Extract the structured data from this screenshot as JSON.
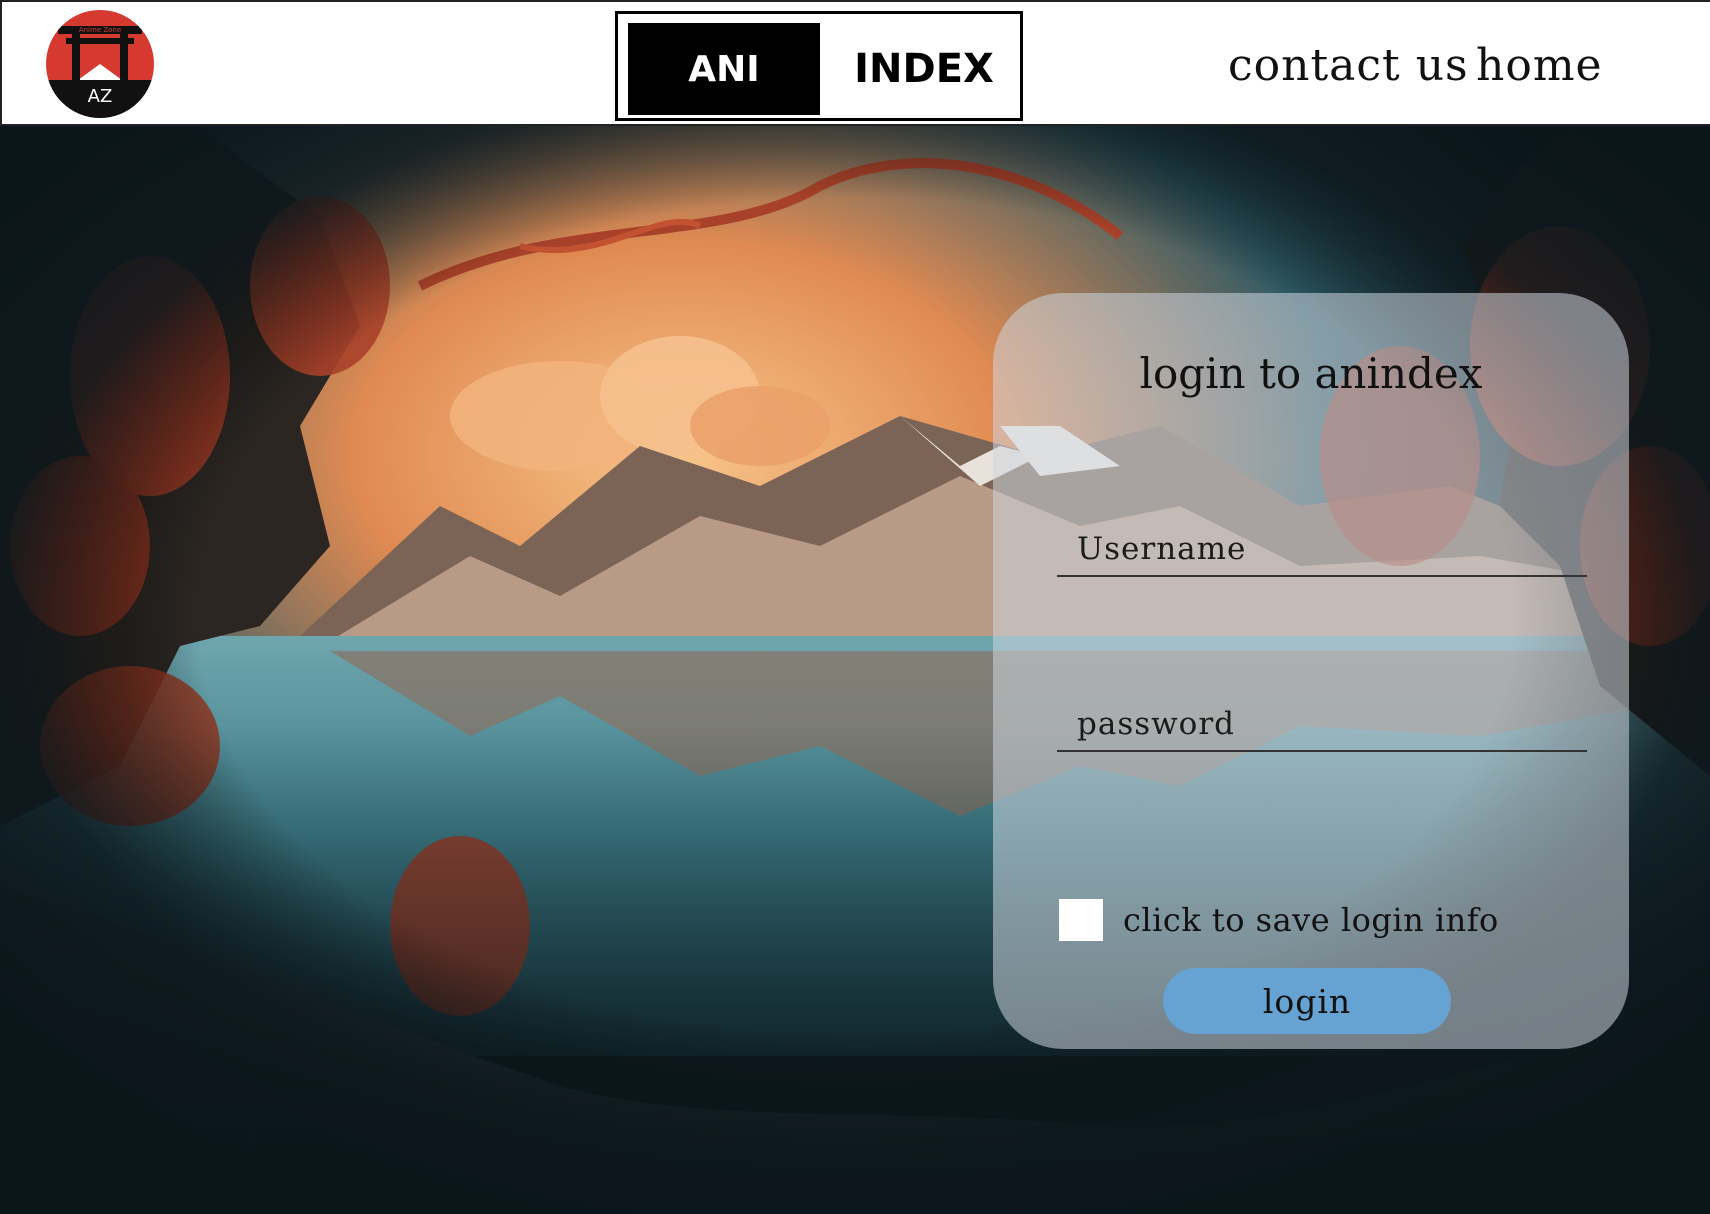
{
  "header": {
    "logo_alt": "Anime Zone",
    "logo_text": "Anime Zone",
    "logo_mark": "AZ",
    "brand_left": "ANI",
    "brand_right": "INDEX",
    "nav": [
      {
        "label": "contact us"
      },
      {
        "label": "home"
      }
    ]
  },
  "login": {
    "title": "login to anindex",
    "username_placeholder": "Username",
    "password_placeholder": "password",
    "save_label": "click to save login info",
    "save_checked": false,
    "button_label": "login"
  },
  "background": {
    "description_icon": "landscape-image",
    "colors": {
      "sky_glow": "#f0a868",
      "water": "#4a8a96",
      "foliage": "#a8412a",
      "dark": "#0f1c22"
    }
  },
  "colors": {
    "panel_bg": "#cdd6de",
    "button_bg": "#66a3d2",
    "header_bg": "#ffffff",
    "brand_black": "#000000",
    "logo_red": "#d6392f"
  }
}
